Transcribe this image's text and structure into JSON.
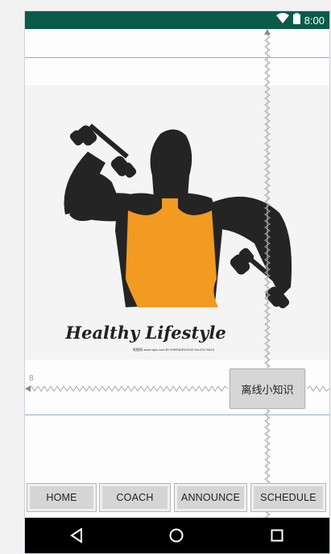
{
  "status_bar": {
    "time": "8:00",
    "icons": [
      "wifi-icon",
      "battery-icon"
    ]
  },
  "hero_image": {
    "caption": "Healthy Lifestyle",
    "small_caption": "昵图网 www.nipic.com  BY:KRENDRGOUD  No:20170815"
  },
  "guides": {
    "margin_label": "8"
  },
  "offline_button": {
    "label": "离线小知识"
  },
  "tabs": [
    {
      "label": "HOME"
    },
    {
      "label": "COACH"
    },
    {
      "label": "ANNOUNCE"
    },
    {
      "label": "SCHEDULE"
    }
  ],
  "nav_bar": {
    "icons": [
      "back-icon",
      "home-icon",
      "recents-icon"
    ]
  },
  "colors": {
    "status_bar": "#0a5b4a",
    "vest": "#f29a22",
    "figure": "#242424",
    "nav_bar": "#000000"
  }
}
